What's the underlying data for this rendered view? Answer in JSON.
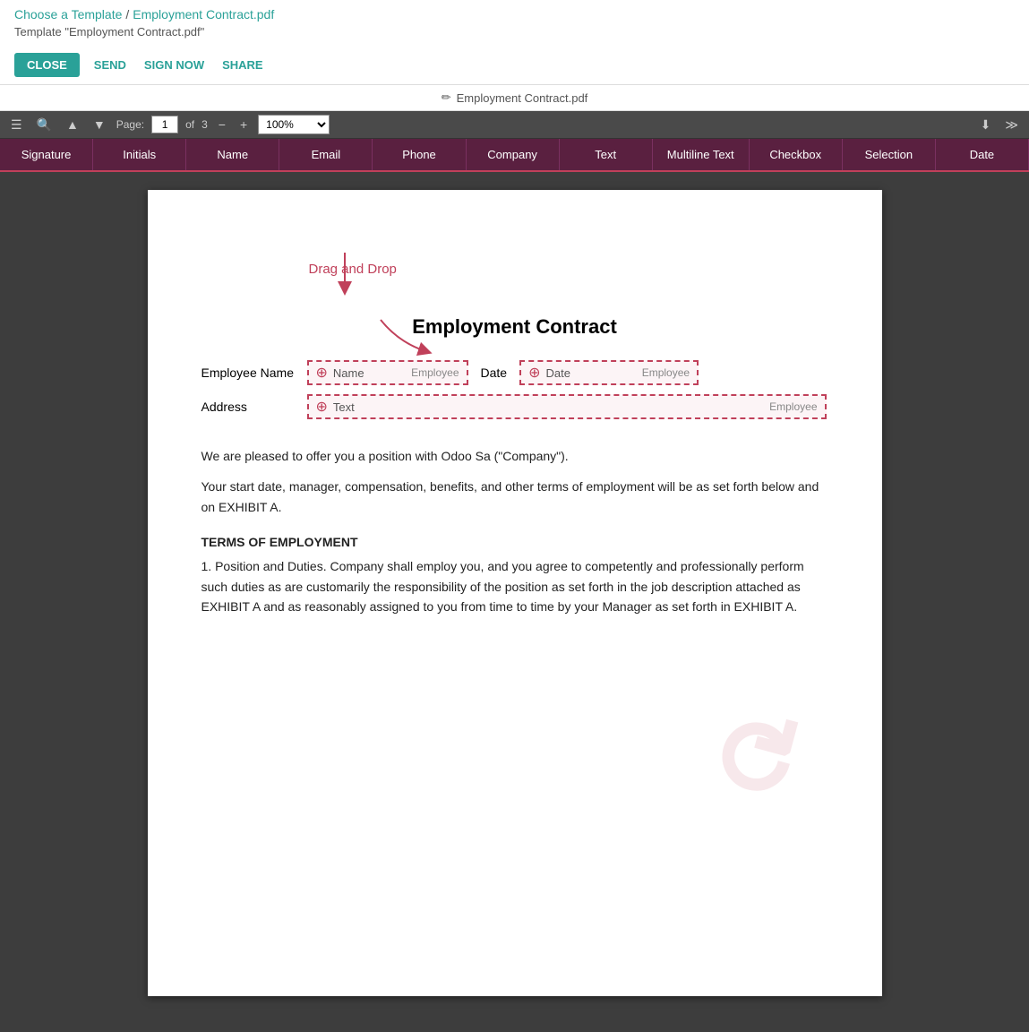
{
  "header": {
    "breadcrumb1": "Choose a Template",
    "separator1": "/",
    "breadcrumb2": "Employment Contract.pdf",
    "separator2": "/",
    "breadcrumb_sub": "Template \"Employment Contract.pdf\"",
    "close_label": "CLOSE",
    "send_label": "SEND",
    "sign_now_label": "SIGN NOW",
    "share_label": "SHARE"
  },
  "pencil_bar": {
    "icon": "✏",
    "filename": "Employment Contract.pdf"
  },
  "pdf_toolbar": {
    "page_current": "1",
    "page_total": "3",
    "zoom_value": "100%"
  },
  "field_tabs": [
    {
      "label": "Signature"
    },
    {
      "label": "Initials"
    },
    {
      "label": "Name"
    },
    {
      "label": "Email"
    },
    {
      "label": "Phone"
    },
    {
      "label": "Company"
    },
    {
      "label": "Text"
    },
    {
      "label": "Multiline Text"
    },
    {
      "label": "Checkbox"
    },
    {
      "label": "Selection"
    },
    {
      "label": "Date"
    }
  ],
  "document": {
    "title": "Employment Contract",
    "drag_drop_label": "Drag and Drop",
    "fields": {
      "employee_name_label": "Employee Name",
      "name_field_type": "Name",
      "name_field_role": "Employee",
      "date_label": "Date",
      "date_field_type": "Date",
      "date_field_role": "Employee",
      "address_label": "Address",
      "text_field_type": "Text",
      "text_field_role": "Employee"
    },
    "paragraphs": [
      "We are pleased to offer you a position with Odoo Sa (\"Company\").",
      "Your start date, manager, compensation, benefits, and other terms of employment will be as set forth below and on EXHIBIT A."
    ],
    "section_title": "TERMS OF EMPLOYMENT",
    "numbered_para": "1.  Position and Duties. Company shall employ you, and you agree to competently and professionally perform such duties as are customarily the responsibility of the position as set forth in the job description attached as EXHIBIT A and as reasonably assigned to you from time to time by your Manager as set forth in EXHIBIT A."
  }
}
